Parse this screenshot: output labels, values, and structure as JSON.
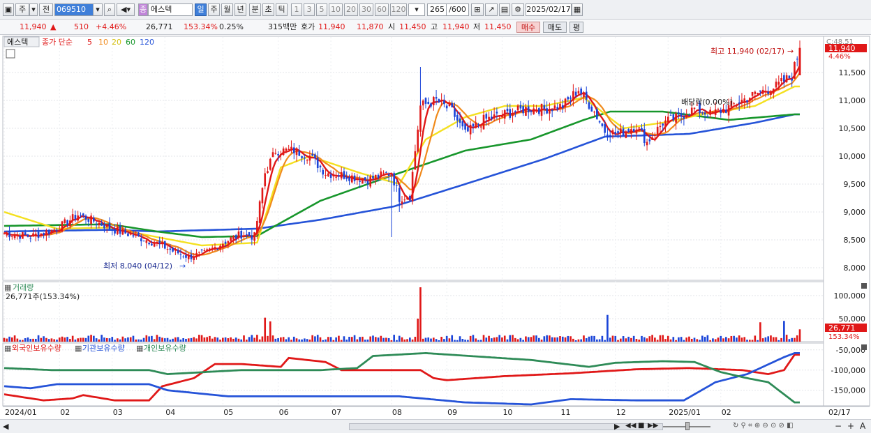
{
  "toolbar": {
    "mode_a": "주",
    "mode_b": "전",
    "code": "069510",
    "market_tag": "종",
    "stock_name": "에스텍",
    "periods": [
      "일",
      "주",
      "월",
      "년",
      "분",
      "초",
      "틱"
    ],
    "selected_period": "일",
    "intervals": [
      "1",
      "3",
      "5",
      "10",
      "20",
      "30",
      "60",
      "120"
    ],
    "count": "265",
    "count_max": "/600",
    "date": "2025/02/17"
  },
  "quote": {
    "price": "11,940",
    "arrow": "▲",
    "change": "510",
    "change_pct": "+4.46%",
    "volume": "26,771",
    "volume_ratio": "153.34%",
    "turnover": "0.25%",
    "amount": "315백만",
    "bid_label": "호가",
    "bid1": "11,940",
    "bid2": "11,870",
    "open_label": "시",
    "open": "11,450",
    "high_label": "고",
    "high": "11,940",
    "low_label": "저",
    "low": "11,450",
    "buy_label": "매수",
    "sell_label": "매도",
    "eval_label": "평"
  },
  "colors": {
    "up": "#e01818",
    "down": "#1a44d8",
    "ma5": "#e01818",
    "ma10": "#f08a1c",
    "ma20": "#f4e020",
    "ma60": "#17962b",
    "ma120": "#2553d8",
    "foreign": "#e01818",
    "inst": "#2553d8",
    "retail": "#2e8b57"
  },
  "chart_data": [
    {
      "type": "candlestick",
      "title": "에스텍",
      "legend": [
        "종가 단순",
        "5",
        "10",
        "20",
        "60",
        "120"
      ],
      "y_ticks": [
        8000,
        8500,
        9000,
        9500,
        10000,
        10500,
        11000,
        11500
      ],
      "y_tick_labels": [
        "8,000",
        "8,500",
        "9,000",
        "9,500",
        "10,000",
        "10,500",
        "11,000",
        "11,500"
      ],
      "ylim": [
        7800,
        12100
      ],
      "x_months": [
        "2024/01",
        "02",
        "03",
        "04",
        "05",
        "06",
        "07",
        "08",
        "09",
        "10",
        "11",
        "12",
        "2025/01",
        "02",
        "02/17"
      ],
      "annotations": {
        "high": "최고 11,940 (02/17)",
        "low": "최저 8,040 (04/12)",
        "dividend": "배당락(0.00%)",
        "top_label": "C:48.51",
        "last_price": "11,940",
        "last_pct": "4.46%"
      },
      "close_anchors": [
        [
          0,
          8620
        ],
        [
          10,
          8560
        ],
        [
          20,
          8700
        ],
        [
          28,
          8950
        ],
        [
          35,
          8820
        ],
        [
          42,
          8680
        ],
        [
          50,
          8560
        ],
        [
          58,
          8440
        ],
        [
          64,
          8300
        ],
        [
          70,
          8200
        ],
        [
          76,
          8250
        ],
        [
          83,
          8450
        ],
        [
          90,
          8600
        ],
        [
          95,
          8560
        ],
        [
          99,
          9700
        ],
        [
          103,
          10100
        ],
        [
          110,
          10100
        ],
        [
          116,
          10000
        ],
        [
          122,
          9700
        ],
        [
          130,
          9650
        ],
        [
          138,
          9580
        ],
        [
          145,
          9680
        ],
        [
          147,
          9700
        ],
        [
          150,
          9250
        ],
        [
          154,
          9300
        ],
        [
          158,
          10900
        ],
        [
          164,
          11000
        ],
        [
          170,
          10800
        ],
        [
          175,
          10400
        ],
        [
          182,
          10650
        ],
        [
          190,
          10750
        ],
        [
          198,
          10850
        ],
        [
          205,
          10850
        ],
        [
          212,
          10900
        ],
        [
          218,
          11200
        ],
        [
          224,
          10800
        ],
        [
          228,
          10450
        ],
        [
          233,
          10400
        ],
        [
          240,
          10550
        ],
        [
          244,
          10250
        ],
        [
          250,
          10600
        ],
        [
          256,
          10700
        ],
        [
          262,
          10850
        ],
        [
          268,
          10750
        ],
        [
          274,
          10850
        ],
        [
          280,
          11000
        ],
        [
          287,
          11150
        ],
        [
          293,
          11250
        ],
        [
          299,
          11440
        ],
        [
          302,
          11940
        ]
      ],
      "ma60_anchors": [
        [
          0,
          8750
        ],
        [
          40,
          8780
        ],
        [
          58,
          8650
        ],
        [
          75,
          8550
        ],
        [
          96,
          8570
        ],
        [
          120,
          9200
        ],
        [
          147,
          9650
        ],
        [
          175,
          10100
        ],
        [
          200,
          10300
        ],
        [
          220,
          10650
        ],
        [
          230,
          10800
        ],
        [
          250,
          10800
        ],
        [
          275,
          10650
        ],
        [
          300,
          10750
        ]
      ],
      "ma120_anchors": [
        [
          0,
          8650
        ],
        [
          40,
          8680
        ],
        [
          58,
          8650
        ],
        [
          96,
          8700
        ],
        [
          120,
          8860
        ],
        [
          148,
          9100
        ],
        [
          175,
          9500
        ],
        [
          205,
          9950
        ],
        [
          228,
          10350
        ],
        [
          260,
          10400
        ],
        [
          285,
          10600
        ],
        [
          300,
          10750
        ]
      ],
      "ma20_anchors": [
        [
          0,
          9000
        ],
        [
          20,
          8700
        ],
        [
          40,
          8720
        ],
        [
          58,
          8550
        ],
        [
          75,
          8400
        ],
        [
          96,
          8450
        ],
        [
          105,
          9800
        ],
        [
          116,
          10000
        ],
        [
          135,
          9700
        ],
        [
          150,
          9500
        ],
        [
          160,
          10300
        ],
        [
          175,
          10700
        ],
        [
          190,
          10900
        ],
        [
          205,
          10900
        ],
        [
          220,
          11050
        ],
        [
          235,
          10500
        ],
        [
          250,
          10600
        ],
        [
          265,
          10750
        ],
        [
          285,
          10900
        ],
        [
          300,
          11250
        ]
      ]
    },
    {
      "type": "bar",
      "title": "거래량",
      "current": "26,771주(153.34%)",
      "y_ticks": [
        50000,
        100000
      ],
      "y_tick_labels": [
        "50,000",
        "100,000"
      ],
      "ylim": [
        0,
        118000
      ],
      "last_value": "26,771",
      "last_pct": "153.34%",
      "spikes": [
        [
          99,
          52000
        ],
        [
          101,
          44000
        ],
        [
          158,
          118000
        ],
        [
          157,
          50000
        ],
        [
          229,
          58000
        ],
        [
          287,
          42000
        ],
        [
          296,
          45000
        ]
      ]
    },
    {
      "type": "line",
      "series": [
        {
          "name": "외국인보유수량",
          "values": [
            [
              0,
              -160000
            ],
            [
              15,
              -175000
            ],
            [
              26,
              -170000
            ],
            [
              30,
              -162000
            ],
            [
              42,
              -175000
            ],
            [
              55,
              -175000
            ],
            [
              60,
              -140000
            ],
            [
              72,
              -120000
            ],
            [
              80,
              -85000
            ],
            [
              90,
              -85000
            ],
            [
              105,
              -92000
            ],
            [
              108,
              -70000
            ],
            [
              122,
              -80000
            ],
            [
              128,
              -100000
            ],
            [
              158,
              -100000
            ],
            [
              163,
              -120000
            ],
            [
              168,
              -125000
            ],
            [
              190,
              -115000
            ],
            [
              215,
              -108000
            ],
            [
              240,
              -98000
            ],
            [
              260,
              -95000
            ],
            [
              280,
              -100000
            ],
            [
              290,
              -110000
            ],
            [
              296,
              -100000
            ],
            [
              300,
              -62000
            ]
          ]
        },
        {
          "name": "기관보유수량",
          "values": [
            [
              0,
              -140000
            ],
            [
              10,
              -145000
            ],
            [
              20,
              -135000
            ],
            [
              55,
              -135000
            ],
            [
              62,
              -150000
            ],
            [
              85,
              -165000
            ],
            [
              110,
              -165000
            ],
            [
              150,
              -165000
            ],
            [
              175,
              -180000
            ],
            [
              200,
              -185000
            ],
            [
              215,
              -172000
            ],
            [
              240,
              -175000
            ],
            [
              258,
              -175000
            ],
            [
              262,
              -160000
            ],
            [
              270,
              -130000
            ],
            [
              282,
              -110000
            ],
            [
              296,
              -68000
            ],
            [
              300,
              -58000
            ]
          ]
        },
        {
          "name": "개인보유수량",
          "values": [
            [
              0,
              -95000
            ],
            [
              18,
              -100000
            ],
            [
              40,
              -100000
            ],
            [
              55,
              -100000
            ],
            [
              62,
              -110000
            ],
            [
              90,
              -100000
            ],
            [
              120,
              -100000
            ],
            [
              134,
              -95000
            ],
            [
              140,
              -65000
            ],
            [
              160,
              -58000
            ],
            [
              200,
              -75000
            ],
            [
              222,
              -92000
            ],
            [
              232,
              -82000
            ],
            [
              250,
              -78000
            ],
            [
              262,
              -80000
            ],
            [
              272,
              -105000
            ],
            [
              282,
              -120000
            ],
            [
              290,
              -130000
            ],
            [
              300,
              -180000
            ]
          ]
        }
      ],
      "y_ticks": [
        -50000,
        -100000,
        -150000
      ],
      "y_tick_labels": [
        "-50,000",
        "-100,000",
        "-150,000"
      ],
      "ylim": [
        -185000,
        -40000
      ]
    }
  ],
  "scroll": {
    "buttons": [
      "▶",
      "◀◀",
      "■",
      "▶▶",
      "−",
      "+",
      "A"
    ]
  }
}
